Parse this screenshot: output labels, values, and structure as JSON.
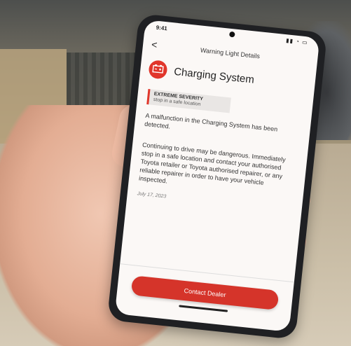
{
  "status": {
    "time": "9:41",
    "icons": "▮▮ ◔ ▭"
  },
  "nav": {
    "back": "<",
    "title": "Warning Light Details"
  },
  "header": {
    "title": "Charging System",
    "icon": "battery-warning-icon"
  },
  "severity": {
    "title": "EXTREME SEVERITY",
    "subtitle": "stop in a safe location"
  },
  "paragraphs": [
    "A malfunction in the Charging System has been detected.",
    "Continuing to drive may be dangerous. Immediately stop in a safe location and contact your authorised Toyota retailer or Toyota authorised repairer, or any reliable repairer in order to have your vehicle inspected."
  ],
  "date": "July 17, 2023",
  "cta": {
    "label": "Contact Dealer"
  },
  "colors": {
    "accent": "#d5342a",
    "screen_bg": "#fbf8f6"
  }
}
